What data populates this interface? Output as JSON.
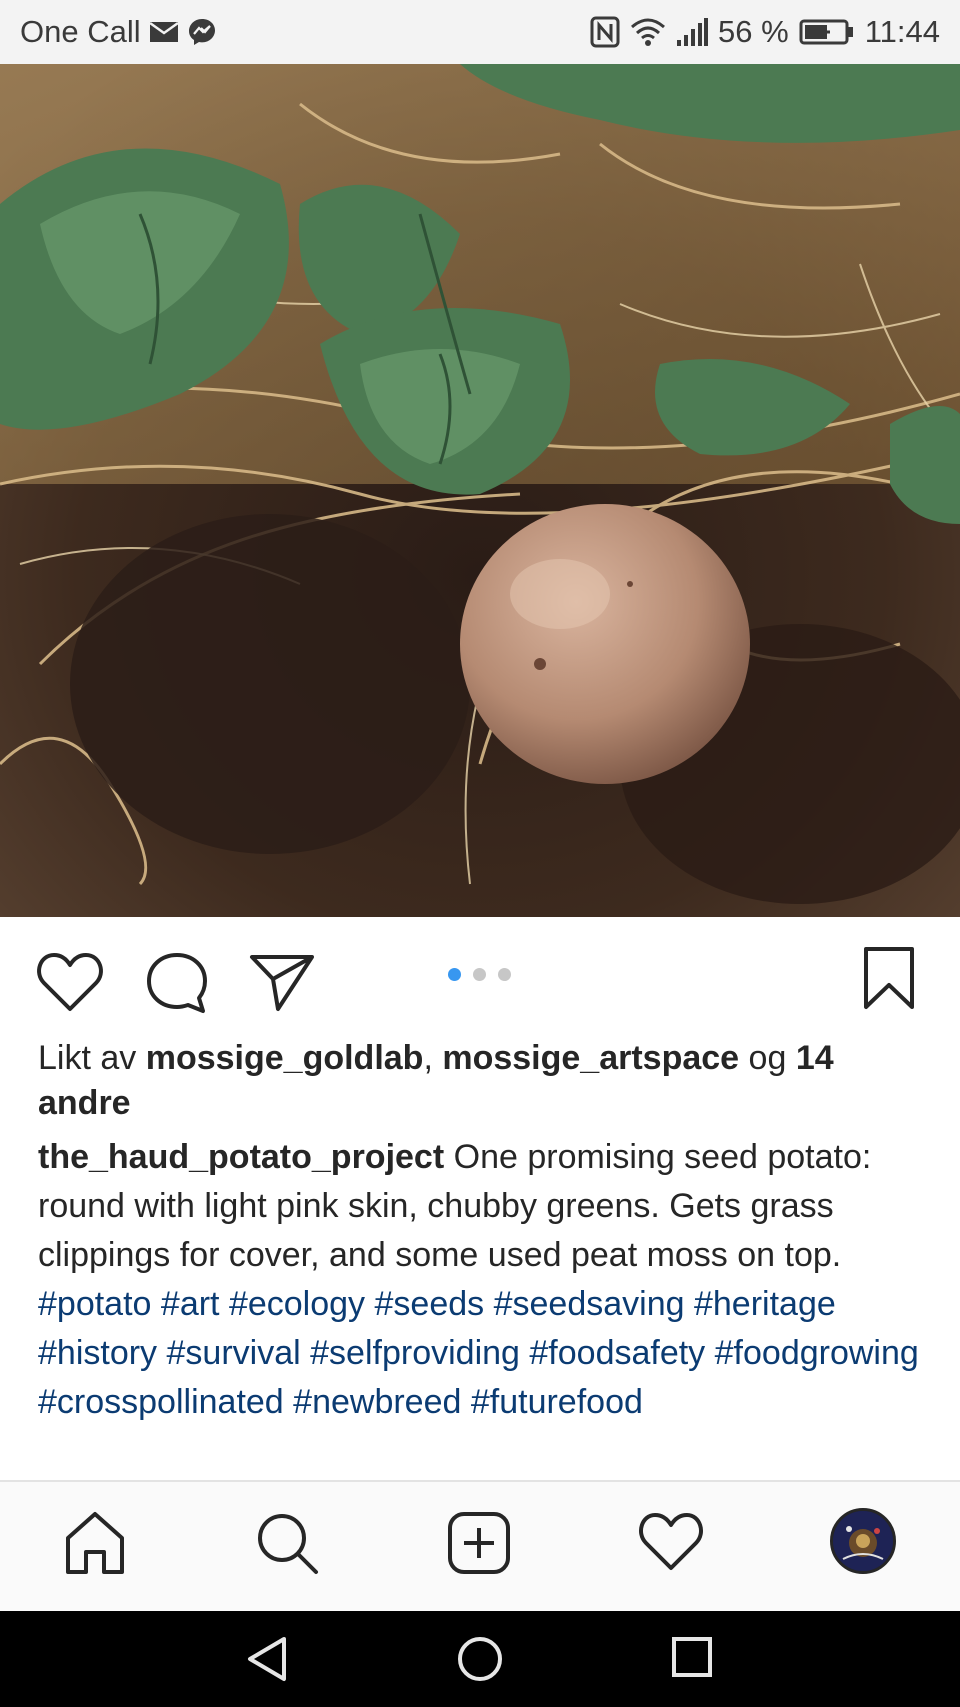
{
  "status_bar": {
    "carrier": "One Call",
    "battery": "56 %",
    "time": "11:44"
  },
  "post": {
    "image_description_icon": "photo",
    "carousel": {
      "count": 3,
      "active_index": 0
    },
    "likes": {
      "prefix": "Likt av",
      "user1": "mossige_goldlab",
      "separator": ",",
      "user2": "mossige_artspace",
      "conjunction": "og",
      "others": "14 andre"
    },
    "caption": {
      "username": "the_haud_potato_project",
      "text": "One promising seed potato: round with light pink skin, chubby greens. Gets grass clippings for cover, and some used peat moss on top.",
      "hashtags": [
        "#potato",
        "#art",
        "#ecology",
        "#seeds",
        "#seedsaving",
        "#heritage",
        "#history",
        "#survival",
        "#selfproviding",
        "#foodsafety",
        "#foodgrowing",
        "#crosspollinated",
        "#newbreed",
        "#futurefood"
      ]
    }
  },
  "actions": {
    "like_icon": "heart-icon",
    "comment_icon": "comment-icon",
    "share_icon": "send-icon",
    "save_icon": "bookmark-icon"
  },
  "bottom_nav": {
    "items": [
      "home-icon",
      "search-icon",
      "add-post-icon",
      "activity-heart-icon",
      "profile-avatar"
    ]
  },
  "system_nav": {
    "items": [
      "back",
      "home",
      "recents"
    ]
  },
  "colors": {
    "accent_blue": "#3897f0",
    "hashtag": "#0b3b72",
    "text": "#262626"
  }
}
